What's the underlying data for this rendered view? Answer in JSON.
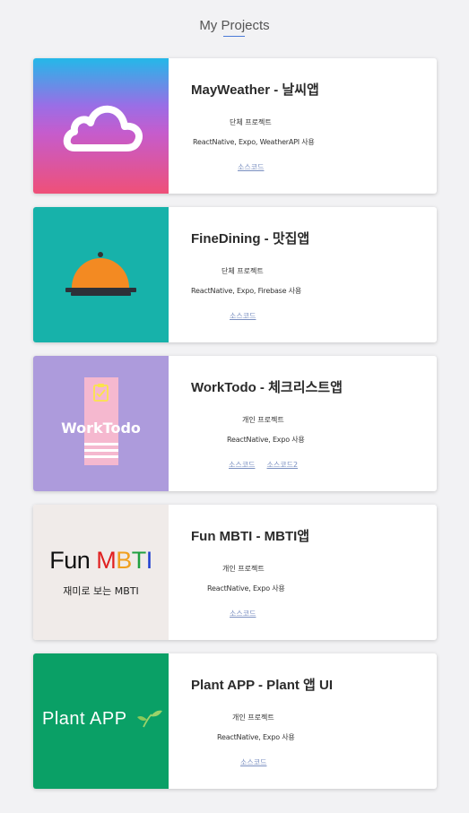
{
  "header": {
    "title": "My Projects"
  },
  "projects": [
    {
      "title": "MayWeather - 날씨앱",
      "type": "단체 프로젝트",
      "stack": "ReactNative, Expo, WeatherAPI 사용",
      "links": [
        "소스코드"
      ],
      "thumb_icon": "cloud-icon"
    },
    {
      "title": "FineDining - 맛집앱",
      "type": "단체 프로젝트",
      "stack": "ReactNative, Expo, Firebase 사용",
      "links": [
        "소스코드"
      ],
      "thumb_icon": "food-cloche-icon"
    },
    {
      "title": "WorkTodo - 체크리스트앱",
      "type": "개인 프로젝트",
      "stack": "ReactNative, Expo 사용",
      "links": [
        "소스코드",
        "소스코드2"
      ],
      "thumb_text": "WorkTodo",
      "thumb_icon": "clipboard-check-icon"
    },
    {
      "title": "Fun MBTI - MBTI앱",
      "type": "개인 프로젝트",
      "stack": "ReactNative, Expo 사용",
      "links": [
        "소스코드"
      ],
      "thumb_text": "Fun",
      "thumb_letters": [
        "M",
        "B",
        "T",
        "I"
      ],
      "thumb_sub": "재미로 보는 MBTI"
    },
    {
      "title": "Plant APP - Plant 앱 UI",
      "type": "개인 프로젝트",
      "stack": "ReactNative, Expo 사용",
      "links": [
        "소스코드"
      ],
      "thumb_text": "Plant  APP",
      "thumb_icon": "sprout-icon"
    }
  ],
  "colors": {
    "background": "#f2f2f4",
    "link": "#7a8fc0",
    "accent": "#4a7ad8",
    "mbti_m": "#e02020",
    "mbti_b": "#f0a020",
    "mbti_t": "#20a040",
    "mbti_i": "#2040d0"
  }
}
